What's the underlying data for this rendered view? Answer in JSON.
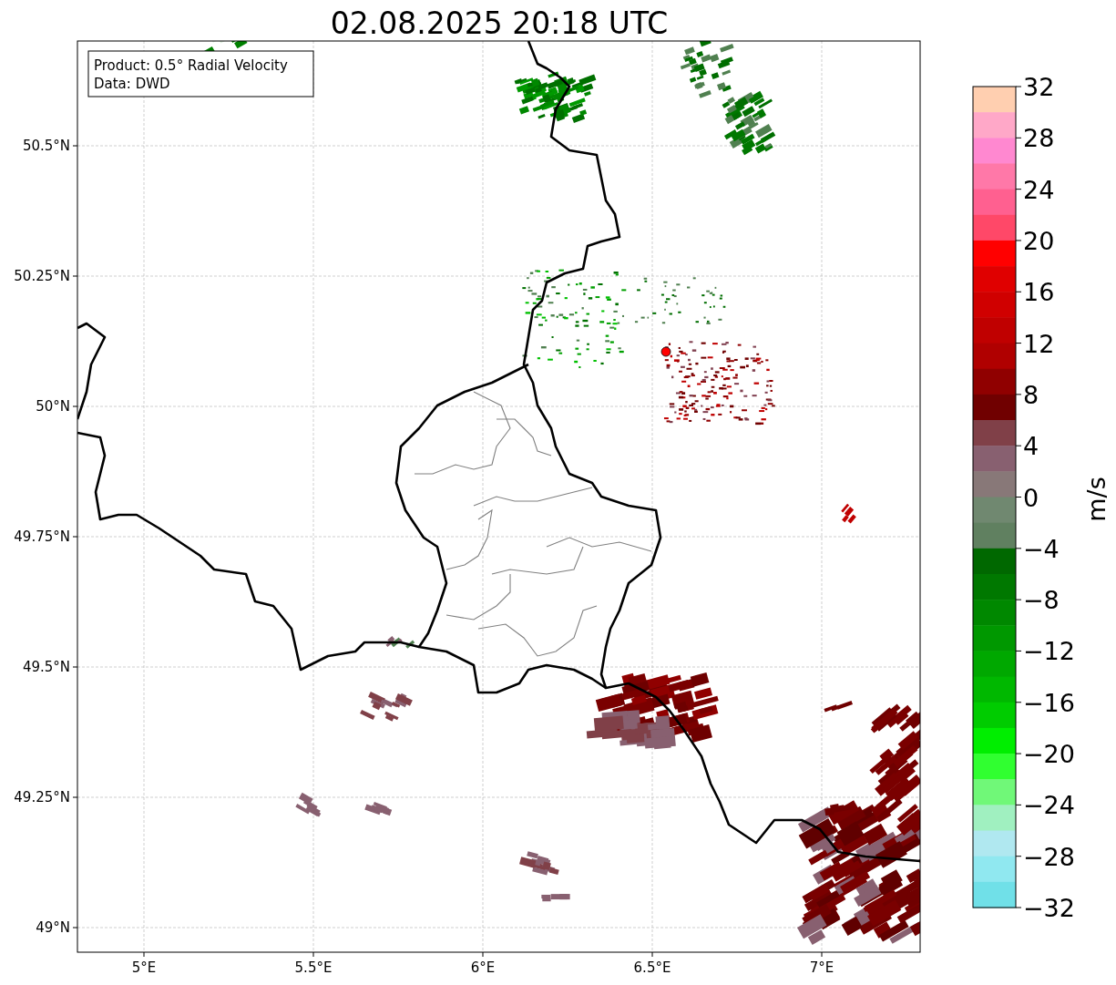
{
  "figure": {
    "title": "02.08.2025 20:18 UTC",
    "x_ticks": [
      "5°E",
      "5.5°E",
      "6°E",
      "6.5°E",
      "7°E"
    ],
    "y_ticks": [
      "50.5°N",
      "50.25°N",
      "50°N",
      "49.75°N",
      "49.5°N",
      "49.25°N",
      "49°N"
    ],
    "legend": [
      "Product: 0.5° Radial Velocity",
      "Data: DWD"
    ],
    "colorbar": {
      "label": "m/s",
      "ticks": [
        "32",
        "28",
        "24",
        "20",
        "16",
        "12",
        "8",
        "4",
        "0",
        "−4",
        "−8",
        "−12",
        "−16",
        "−20",
        "−24",
        "−28",
        "−32"
      ]
    }
  }
}
